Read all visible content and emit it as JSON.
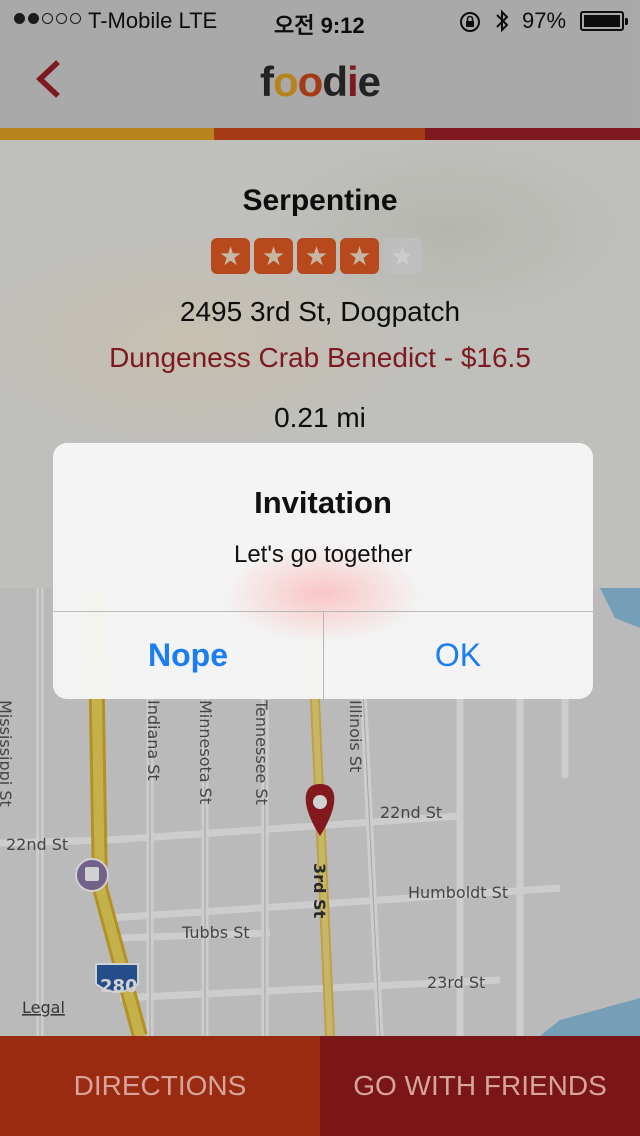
{
  "status": {
    "carrier": "T-Mobile  LTE",
    "time": "오전 9:12",
    "battery": "97%",
    "signal_bars_filled": 2,
    "signal_bars_total": 5
  },
  "nav": {
    "back_icon": "chevron-left-icon",
    "logo": [
      "f",
      "o",
      "o",
      "d",
      "i",
      "e"
    ],
    "logo_colors": [
      "#2a2a2a",
      "#e0a024",
      "#c8481b",
      "#2a2a2a",
      "#9a1f28",
      "#2a2a2a"
    ],
    "bar_colors": [
      "#e0a024",
      "#c8481b",
      "#9a1f28"
    ]
  },
  "restaurant": {
    "name": "Serpentine",
    "rating": 4,
    "rating_max": 5,
    "address": "2495 3rd St, Dogpatch",
    "dish": "Dungeness Crab Benedict - $16.5",
    "distance": "0.21 mi"
  },
  "map": {
    "streets": [
      "Mississippi St",
      "Indiana St",
      "Minnesota St",
      "Tennessee St",
      "Illinois St",
      "22nd St",
      "22nd St",
      "3rd St",
      "Humboldt St",
      "Tubbs St",
      "23rd St"
    ],
    "freeway_shield": "280",
    "legal": "Legal",
    "pin_icon": "map-pin-icon",
    "train_icon": "train-icon"
  },
  "alert": {
    "title": "Invitation",
    "message": "Let's go together",
    "cancel": "Nope",
    "ok": "OK"
  },
  "bottom": {
    "directions": "DIRECTIONS",
    "friends": "GO WITH FRIENDS",
    "directions_color": "#9a2a10",
    "friends_color": "#7a1618"
  }
}
